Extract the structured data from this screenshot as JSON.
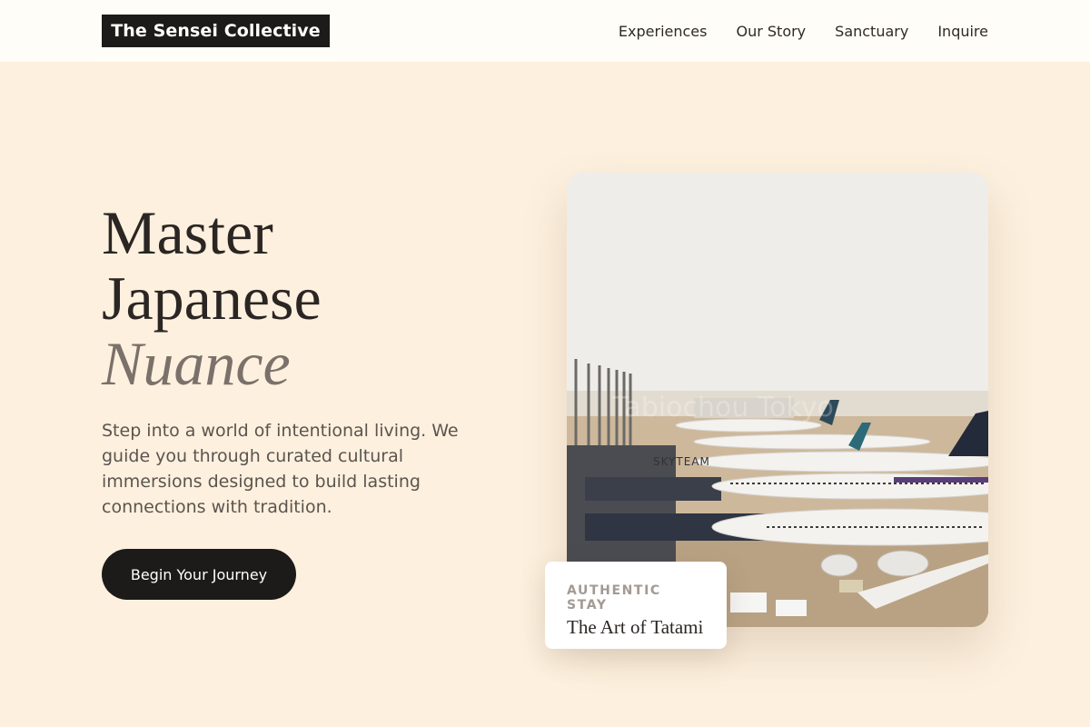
{
  "header": {
    "logo": "The Sensei Collective",
    "nav": [
      "Experiences",
      "Our Story",
      "Sanctuary",
      "Inquire"
    ]
  },
  "hero": {
    "title_line1": "Master",
    "title_line2": "Japanese",
    "title_accent": "Nuance",
    "description": "Step into a world of intentional living. We guide you through curated cultural immersions designed to build lasting connections with tradition.",
    "cta_label": "Begin Your Journey"
  },
  "feature": {
    "image_alt": "Airport apron with parked airliners",
    "eyebrow": "AUTHENTIC STAY",
    "title": "The Art of Tatami"
  },
  "colors": {
    "background": "#fdf0de",
    "dark": "#1c1b1a",
    "accent_text": "#7a716a"
  }
}
